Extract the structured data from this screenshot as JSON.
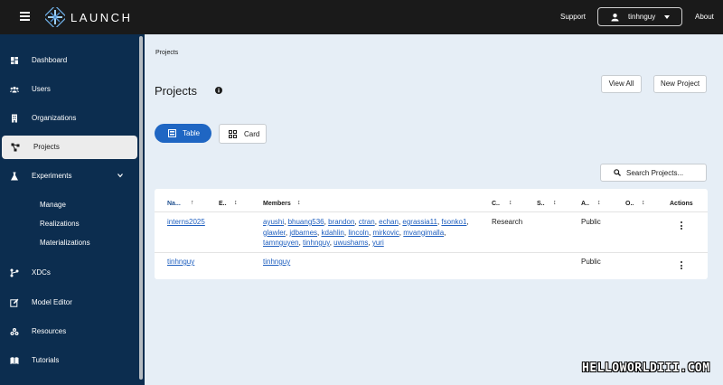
{
  "header": {
    "brand": "LAUNCH",
    "support": "Support",
    "username": "tinhnguy",
    "about": "About"
  },
  "sidebar": {
    "items": [
      {
        "label": "Dashboard",
        "icon": "dashboard-icon"
      },
      {
        "label": "Users",
        "icon": "users-icon"
      },
      {
        "label": "Organizations",
        "icon": "building-icon"
      },
      {
        "label": "Projects",
        "icon": "project-nodes-icon",
        "active": true
      },
      {
        "label": "Experiments",
        "icon": "flask-icon"
      },
      {
        "label": "XDCs",
        "icon": "xdc-icon"
      },
      {
        "label": "Model Editor",
        "icon": "edit-icon"
      },
      {
        "label": "Resources",
        "icon": "resources-icon"
      },
      {
        "label": "Tutorials",
        "icon": "book-icon"
      }
    ],
    "experiments_sub": [
      "Manage",
      "Realizations",
      "Materializations"
    ]
  },
  "main": {
    "breadcrumb": "Projects",
    "title": "Projects",
    "view_all": "View All",
    "new_project": "New Project",
    "view_table": "Table",
    "view_card": "Card",
    "search_placeholder": "Search Projects...",
    "columns": [
      "Na...",
      "E..",
      "Members",
      "C..",
      "S..",
      "A..",
      "O..",
      "Actions"
    ],
    "rows": [
      {
        "name": "interns2025",
        "members": [
          "ayushi",
          "bhuang536",
          "brandon",
          "ctran",
          "echan",
          "egrassia11",
          "fsonko1",
          "glawler",
          "jdbarnes",
          "kdahlin",
          "lincoln",
          "mirkovic",
          "mvangimalla",
          "tamnguyen",
          "tinhnguy",
          "uwushams",
          "yuri"
        ],
        "category": "Research",
        "access": "Public"
      },
      {
        "name": "tinhnguy",
        "members": [
          "tinhnguy"
        ],
        "category": "",
        "access": "Public"
      }
    ]
  },
  "watermark": "HELLOWORLDIII.COM"
}
